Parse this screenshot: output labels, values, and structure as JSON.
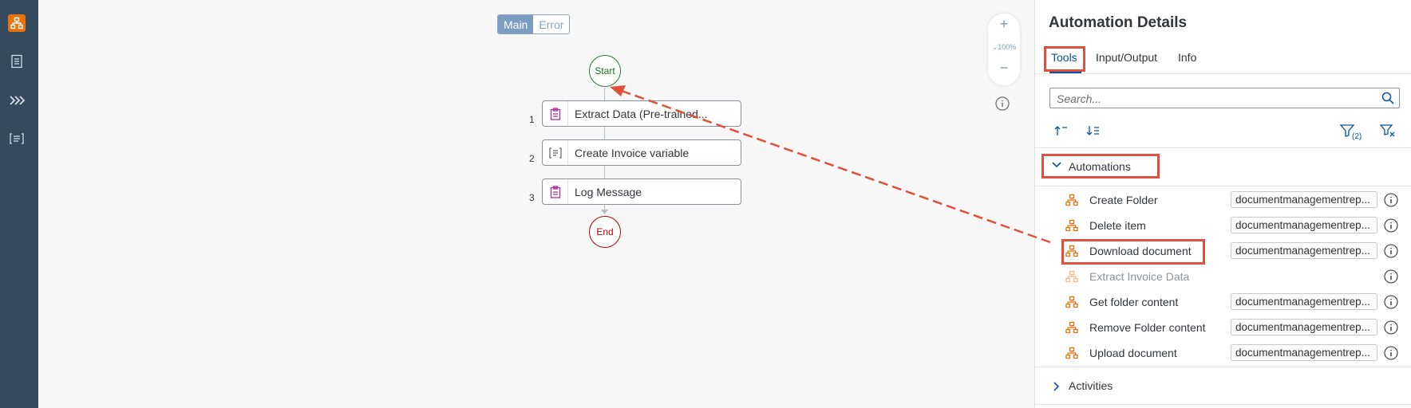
{
  "nav": {
    "items": [
      {
        "icon": "automation-icon",
        "active": true
      },
      {
        "icon": "document-icon",
        "active": false
      },
      {
        "icon": "chevrons-right-icon",
        "active": false
      },
      {
        "icon": "list-icon",
        "active": false
      }
    ]
  },
  "canvas": {
    "toggle": {
      "main": "Main",
      "error": "Error",
      "selected": "Main"
    },
    "zoom": {
      "plus": "+",
      "minus": "−",
      "level": "100%"
    },
    "flow": {
      "start": "Start",
      "end": "End",
      "steps": [
        {
          "number": "1",
          "label": "Extract Data (Pre-trained...",
          "icon": "clipboard-icon"
        },
        {
          "number": "2",
          "label": "Create Invoice variable",
          "icon": "variable-icon"
        },
        {
          "number": "3",
          "label": "Log Message",
          "icon": "clipboard-icon"
        }
      ]
    }
  },
  "panel": {
    "title": "Automation Details",
    "tabs": [
      {
        "label": "Tools",
        "selected": true
      },
      {
        "label": "Input/Output",
        "selected": false
      },
      {
        "label": "Info",
        "selected": false
      }
    ],
    "search": {
      "placeholder": "Search..."
    },
    "toolbar": {
      "filter_count": "(2)"
    },
    "sections": {
      "automations": {
        "label": "Automations",
        "expanded": true,
        "items": [
          {
            "name": "Create Folder",
            "tag": "documentmanagementrep...",
            "enabled": true
          },
          {
            "name": "Delete item",
            "tag": "documentmanagementrep...",
            "enabled": true
          },
          {
            "name": "Download document",
            "tag": "documentmanagementrep...",
            "enabled": true
          },
          {
            "name": "Extract Invoice Data",
            "tag": "",
            "enabled": false
          },
          {
            "name": "Get folder content",
            "tag": "documentmanagementrep...",
            "enabled": true
          },
          {
            "name": "Remove Folder content",
            "tag": "documentmanagementrep...",
            "enabled": true
          },
          {
            "name": "Upload document",
            "tag": "documentmanagementrep...",
            "enabled": true
          }
        ]
      },
      "activities": {
        "label": "Activities",
        "expanded": false
      }
    }
  },
  "colors": {
    "rail": "#354a5f",
    "accent": "#0854a0",
    "orange": "#e9730c",
    "highlight": "#e0503c",
    "start": "#2b7c2b",
    "end": "#bb0000"
  }
}
